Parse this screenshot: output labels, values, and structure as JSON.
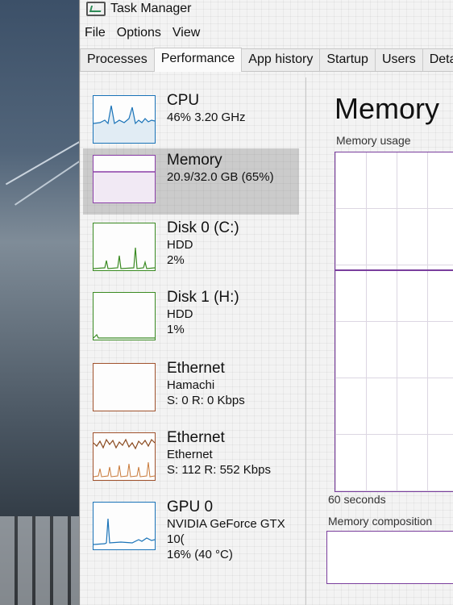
{
  "window": {
    "title": "Task Manager"
  },
  "menu": [
    "File",
    "Options",
    "View"
  ],
  "tabs": [
    "Processes",
    "Performance",
    "App history",
    "Startup",
    "Users",
    "Detail"
  ],
  "active_tab": "Performance",
  "sidebar": {
    "items": [
      {
        "title": "CPU",
        "lines": [
          "46% 3.20 GHz"
        ],
        "color": "#1a73b8",
        "selected": false
      },
      {
        "title": "Memory",
        "lines": [
          "20.9/32.0 GB (65%)"
        ],
        "color": "#8b3fa8",
        "selected": true
      },
      {
        "title": "Disk 0 (C:)",
        "lines": [
          "HDD",
          "2%"
        ],
        "color": "#3a8a22",
        "selected": false
      },
      {
        "title": "Disk 1 (H:)",
        "lines": [
          "HDD",
          "1%"
        ],
        "color": "#3a8a22",
        "selected": false
      },
      {
        "title": "Ethernet",
        "lines": [
          "Hamachi",
          "S: 0 R: 0 Kbps"
        ],
        "color": "#a0522d",
        "selected": false
      },
      {
        "title": "Ethernet",
        "lines": [
          "Ethernet",
          "S: 112 R: 552 Kbps"
        ],
        "color": "#a0522d",
        "selected": false
      },
      {
        "title": "GPU 0",
        "lines": [
          "NVIDIA GeForce GTX 10(",
          "16% (40 °C)"
        ],
        "color": "#1a73b8",
        "selected": false
      }
    ]
  },
  "main": {
    "title": "Memory",
    "usage_label": "Memory usage",
    "seconds_label": "60 seconds",
    "composition_label": "Memory composition"
  },
  "colors": {
    "accent": "#7a3e9d"
  }
}
